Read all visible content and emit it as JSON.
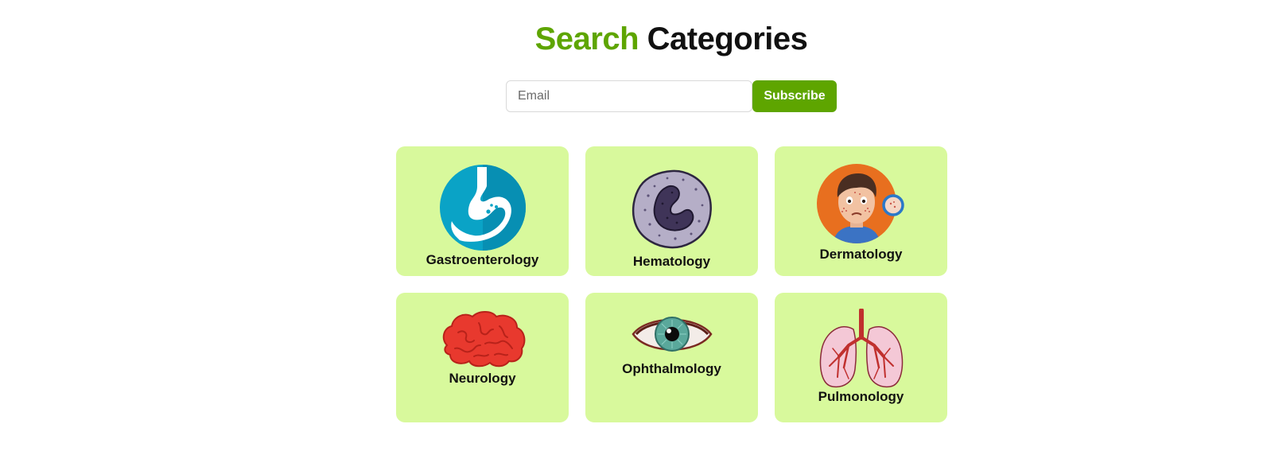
{
  "header": {
    "title_accent": "Search",
    "title_rest": "Categories",
    "accent_color": "#5ea500"
  },
  "subscribe": {
    "placeholder": "Email",
    "value": "",
    "button_label": "Subscribe"
  },
  "categories": [
    {
      "label": "Gastroenterology",
      "icon": "stomach-icon"
    },
    {
      "label": "Hematology",
      "icon": "blood-cell-icon"
    },
    {
      "label": "Dermatology",
      "icon": "skin-patient-icon"
    },
    {
      "label": "Neurology",
      "icon": "brain-icon"
    },
    {
      "label": "Ophthalmology",
      "icon": "eye-icon"
    },
    {
      "label": "Pulmonology",
      "icon": "lungs-icon"
    }
  ],
  "colors": {
    "card_background": "#d8f99c",
    "button_background": "#5ea500"
  }
}
